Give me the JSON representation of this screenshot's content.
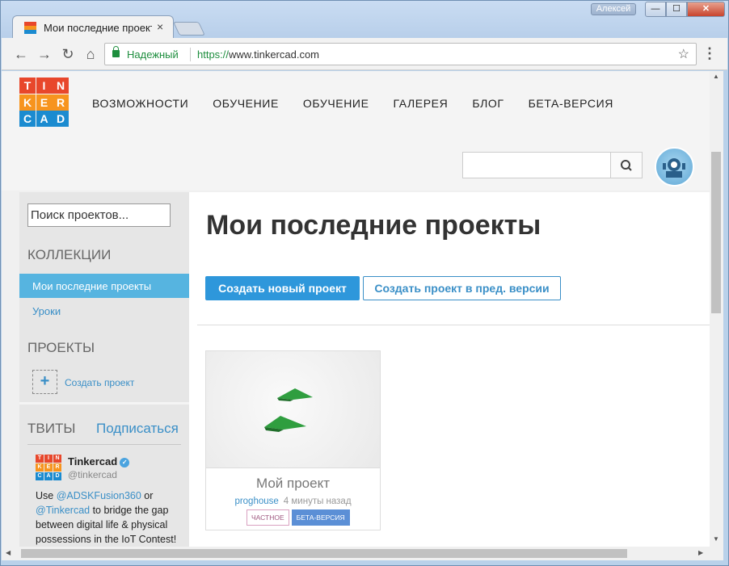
{
  "browser": {
    "tab_title": "Мои последние проекты",
    "tab_close": "×",
    "user_badge": "Алексей",
    "window_buttons": {
      "minimize": "—",
      "maximize": "☐",
      "close": "✕"
    },
    "nav": {
      "back": "←",
      "forward": "→",
      "reload": "↻",
      "home": "⌂"
    },
    "secure_label": "Надежный",
    "url_scheme": "https://",
    "url_host": "www.tinkercad.com",
    "star": "☆",
    "menu": "⋮"
  },
  "site": {
    "logo_letters": [
      "T",
      "I",
      "N",
      "K",
      "E",
      "R",
      "C",
      "A",
      "D"
    ],
    "logo_colors": [
      "#e8472b",
      "#e8472b",
      "#e8472b",
      "#f7941e",
      "#f7941e",
      "#f7941e",
      "#1b8bd0",
      "#1b8bd0",
      "#1b8bd0"
    ],
    "nav_items": [
      "ВОЗМОЖНОСТИ",
      "ОБУЧЕНИЕ",
      "ОБУЧЕНИЕ",
      "ГАЛЕРЕЯ",
      "БЛОГ",
      "БЕТА-ВЕРСИЯ"
    ],
    "search_value": ""
  },
  "sidebar": {
    "project_search_value": "Поиск проектов...",
    "collections_heading": "КОЛЛЕКЦИИ",
    "collections": [
      {
        "label": "Мои последние проекты",
        "active": true
      },
      {
        "label": "Уроки",
        "active": false
      }
    ],
    "projects_heading": "ПРОЕКТЫ",
    "create_project_plus": "+",
    "create_project_label": "Создать проект",
    "tweets_heading": "ТВИТЫ",
    "subscribe_label": "Подписаться",
    "tweet": {
      "name": "Tinkercad",
      "verified": "✓",
      "handle": "@tinkercad",
      "text_1": "Use ",
      "link_1": "@ADSKFusion360",
      "text_2": " or ",
      "link_2": "@Tinkercad",
      "text_3": " to bridge the gap between digital life & physical possessions in the IoT Contest!"
    }
  },
  "main": {
    "title": "Мои последние проекты",
    "create_new_label": "Создать новый проект",
    "create_legacy_label": "Создать проект в пред. версии",
    "projects": [
      {
        "title": "Мой проект",
        "owner": "proghouse",
        "time": "4 минуты назад",
        "badge_private": "ЧАСТНОЕ",
        "badge_beta": "БЕТА-ВЕРСИЯ"
      }
    ]
  },
  "scrollbars": {
    "up": "▲",
    "down": "▼",
    "left": "◀",
    "right": "▶"
  },
  "colors": {
    "accent": "#2e97db",
    "active_item": "#56b4e0",
    "secure": "#1e8e3e"
  }
}
